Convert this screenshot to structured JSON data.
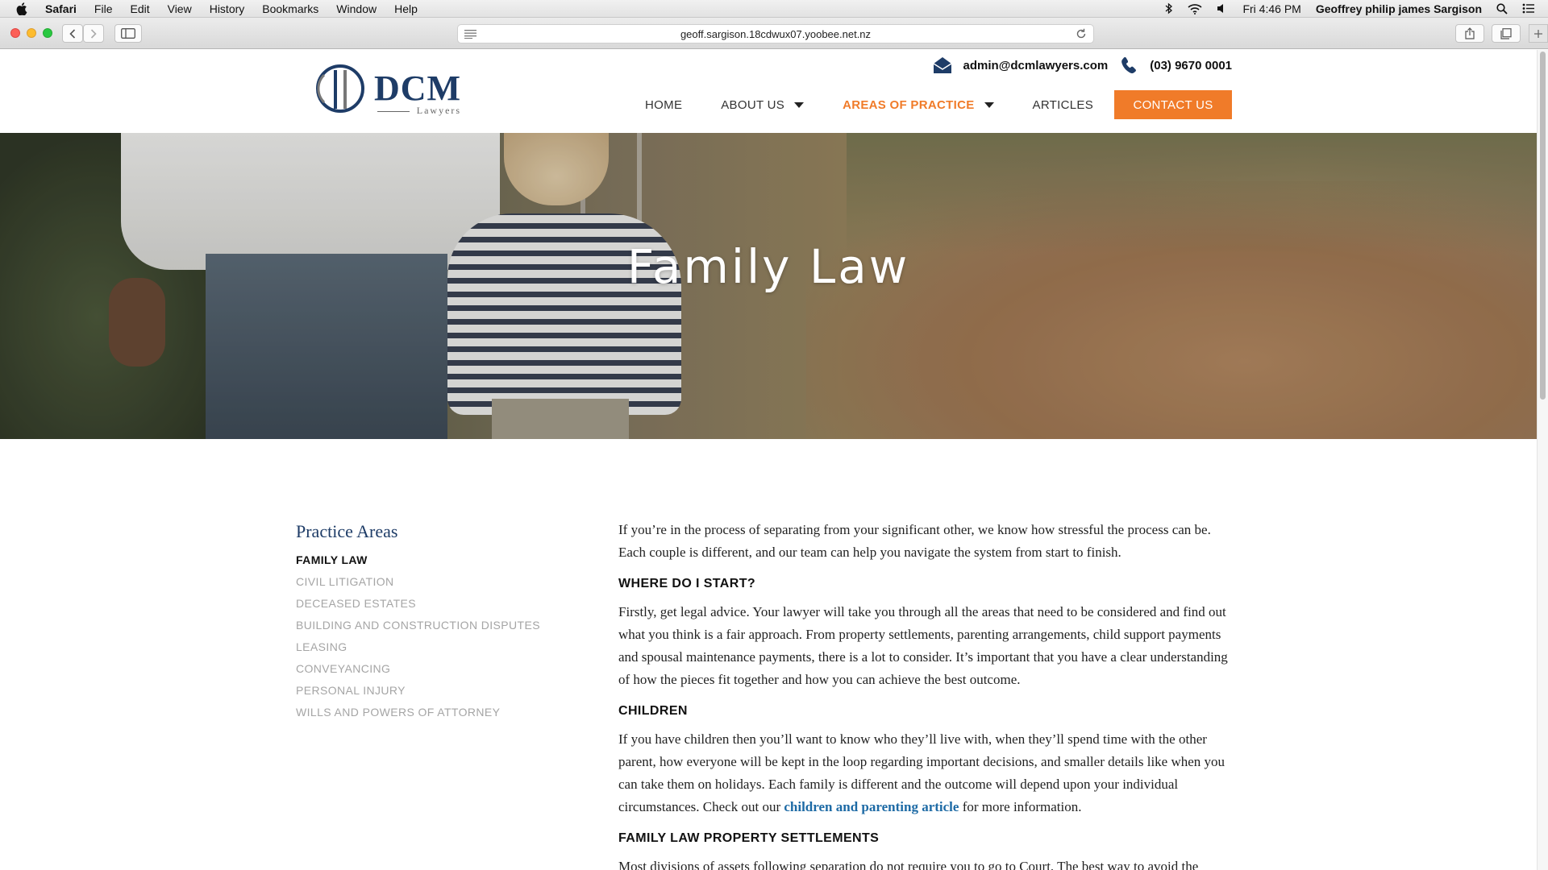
{
  "menubar": {
    "app": "Safari",
    "items": [
      "File",
      "Edit",
      "View",
      "History",
      "Bookmarks",
      "Window",
      "Help"
    ],
    "clock": "Fri 4:46 PM",
    "user": "Geoffrey philip james Sargison"
  },
  "browser": {
    "url": "geoff.sargison.18cdwux07.yoobee.net.nz"
  },
  "site": {
    "logo_main": "DCM",
    "logo_sub": "Lawyers",
    "email": "admin@dcmlawyers.com",
    "phone": "(03) 9670 0001",
    "nav": {
      "home": "HOME",
      "about": "ABOUT US",
      "areas": "AREAS OF PRACTICE",
      "articles": "ARTICLES",
      "contact": "CONTACT US"
    },
    "accent_color": "#f07b29",
    "brand_color": "#1e3c67"
  },
  "hero": {
    "title": "Family Law"
  },
  "sidebar": {
    "title": "Practice Areas",
    "items": [
      "FAMILY LAW",
      "CIVIL LITIGATION",
      "DECEASED ESTATES",
      "BUILDING AND CONSTRUCTION DISPUTES",
      "LEASING",
      "CONVEYANCING",
      "PERSONAL INJURY",
      "WILLS AND POWERS OF ATTORNEY"
    ]
  },
  "article": {
    "intro": "If you’re in the process of separating from your significant other, we know how stressful the process can be. Each couple is different, and our team can help you navigate the system from start to finish.",
    "h1": "WHERE DO I START?",
    "p1": "Firstly, get legal advice. Your lawyer will take you through all the areas that need to be considered and find out what you think is a fair approach. From property settlements, parenting arrangements, child support payments and spousal maintenance payments, there is a lot to consider. It’s important that you have a clear understanding of how the pieces fit together and how you can achieve the best outcome.",
    "h2": "CHILDREN",
    "p2_before": "If you have children then you’ll want to know who they’ll live with, when they’ll spend time with the other parent, how everyone will be kept in the loop regarding important decisions, and smaller details like when you can take them on holidays. Each family is different and the outcome will depend upon your individual circumstances. Check out our ",
    "p2_link": "children and parenting article",
    "p2_after": " for more information.",
    "h3": "FAMILY LAW PROPERTY SETTLEMENTS",
    "p3": "Most divisions of assets following separation do not require you to go to Court. The best way to avoid the"
  }
}
